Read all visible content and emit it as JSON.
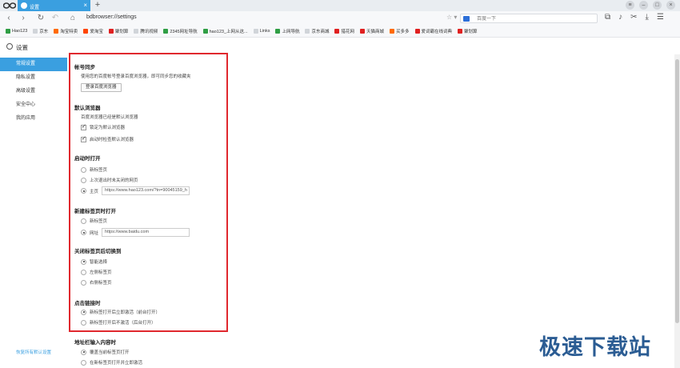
{
  "tab": {
    "label": "设置",
    "close": "×"
  },
  "new_tab": "+",
  "window": {
    "menu": "≡",
    "minimize": "–",
    "maximize": "□",
    "close": "×"
  },
  "nav": {
    "back": "‹",
    "forward": "›",
    "reload": "↻",
    "undo": "↶",
    "home": "⌂"
  },
  "address": "bdbrowser://settings",
  "search": {
    "placeholder": "百度一下"
  },
  "toolbar_icons": [
    "new-window-icon",
    "speaker-icon",
    "scissors-icon",
    "download-icon",
    "menu-icon"
  ],
  "bookmarks": [
    {
      "label": "Hao123",
      "color": "#2f9e44"
    },
    {
      "label": "京东",
      "color": "#d0d4d9"
    },
    {
      "label": "淘宝特卖",
      "color": "#ff6a00"
    },
    {
      "label": "爱淘宝",
      "color": "#ff4400"
    },
    {
      "label": "聚划算",
      "color": "#e02020"
    },
    {
      "label": "腾讯视频",
      "color": "#d0d4d9"
    },
    {
      "label": "2345网址导航",
      "color": "#2f9e44"
    },
    {
      "label": "hao123_上网从这...",
      "color": "#2f9e44"
    },
    {
      "label": "Links",
      "color": "#d0d4d9"
    },
    {
      "label": "上网导航",
      "color": "#2f9e44"
    },
    {
      "label": "京东商城",
      "color": "#d0d4d9"
    },
    {
      "label": "猎花网",
      "color": "#e02020"
    },
    {
      "label": "天猫商城",
      "color": "#e02020"
    },
    {
      "label": "买多多",
      "color": "#ff6a00"
    },
    {
      "label": "爱词霸在线词典",
      "color": "#e02020"
    },
    {
      "label": "聚划算",
      "color": "#e02020"
    }
  ],
  "settings_title": "设置",
  "sidebar": {
    "items": [
      "常规设置",
      "隐私设置",
      "高级设置",
      "安全中心",
      "我的应用"
    ],
    "restore": "恢复所有默认设置"
  },
  "sections": {
    "sync": {
      "title": "帐号同步",
      "desc": "使用您的百度帐号登录百度浏览器，即可同步您的收藏夹",
      "button": "登录百度浏览器"
    },
    "default_browser": {
      "title": "默认浏览器",
      "desc": "百度浏览器已经是默认浏览器",
      "options": [
        "锁定为默认浏览器",
        "启动时检查默认浏览器"
      ]
    },
    "startup": {
      "title": "启动时打开",
      "options": [
        "新标签页",
        "上次退出时未关闭的网页",
        "主页"
      ],
      "homepage": "https://www.hao123.com/?tn=90045159_h"
    },
    "new_tab": {
      "title": "新建标签页时打开",
      "options": [
        "新标签页",
        "网址"
      ],
      "url": "https://www.baidu.com"
    },
    "close_tab": {
      "title": "关闭标签页后切换到",
      "options": [
        "智能选择",
        "左侧标签页",
        "右侧标签页"
      ]
    },
    "click_link": {
      "title": "点击链接时",
      "options": [
        "新标签打开后立即激活（前台打开）",
        "新标签打开后不激活（后台打开）"
      ]
    },
    "address_input": {
      "title": "地址栏输入内容时",
      "options": [
        "覆盖当前标签页打开",
        "在新标签页打开并立即激活"
      ]
    }
  },
  "watermark": "极速下载站"
}
